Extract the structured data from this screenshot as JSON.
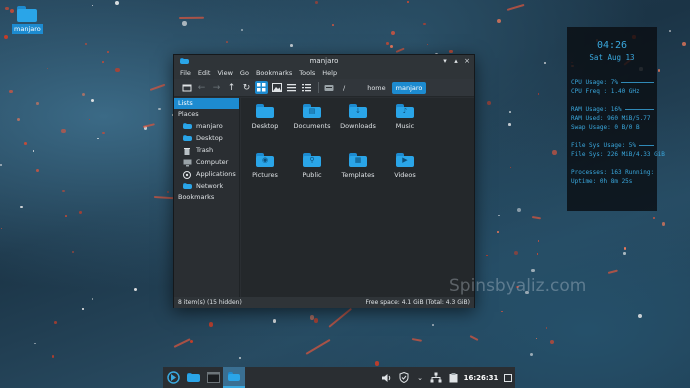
{
  "desktop": {
    "icon_label": "manjaro"
  },
  "window": {
    "title": "manjaro",
    "menu": [
      "File",
      "Edit",
      "View",
      "Go",
      "Bookmarks",
      "Tools",
      "Help"
    ],
    "breadcrumb": {
      "root": "/",
      "home": "home",
      "current": "manjaro"
    },
    "sidebar": {
      "list_label": "Lists",
      "places_header": "Places",
      "places": [
        "manjaro",
        "Desktop",
        "Trash",
        "Computer",
        "Applications",
        "Network"
      ],
      "bookmarks_header": "Bookmarks"
    },
    "items": [
      "Desktop",
      "Documents",
      "Downloads",
      "Music",
      "Pictures",
      "Public",
      "Templates",
      "Videos"
    ],
    "status_left": "8 item(s) (15 hidden)",
    "status_right": "Free space: 4.1 GiB (Total: 4.3 GiB)"
  },
  "conky": {
    "time": "04:26",
    "date": "Sat Aug 13",
    "cpu_usage": "CPU Usage: 7%",
    "cpu_freq": "CPU Freq : 1.40 GHz",
    "ram_usage": "RAM Usage: 16%",
    "ram": "RAM Used: 960 MiB/5.77",
    "swap": "Swap Usage: 0 B/0 B",
    "fs_usage": "File Sys Usage:  5%",
    "fs": "File Sys: 226 MiB/4.33 GiB",
    "processes": "Processes: 163   Running:",
    "uptime": "Uptime: 0h 8m 25s"
  },
  "watermark": "Spinsbyaliz.com",
  "taskbar": {
    "clock": "16:26:31"
  },
  "colors": {
    "accent": "#1d8bd0",
    "conky_text": "#3aa8de",
    "window_bg": "#2a2e32"
  }
}
